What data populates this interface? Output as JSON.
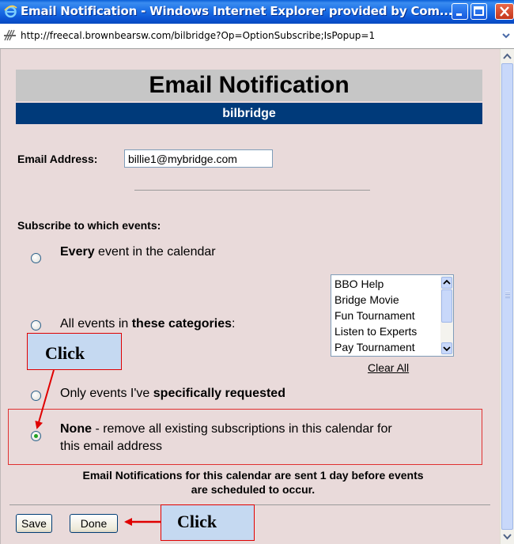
{
  "window": {
    "title": "Email Notification - Windows Internet Explorer provided by Com..."
  },
  "address_bar": {
    "url": "http://freecal.brownbearsw.com/bilbridge?Op=OptionSubscribe;IsPopup=1"
  },
  "page": {
    "heading": "Email Notification",
    "calendar_name": "bilbridge",
    "email_label": "Email Address:",
    "email_value": "billie1@mybridge.com",
    "subscribe_label": "Subscribe to which events:",
    "options": {
      "every": {
        "bold": "Every",
        "rest": " event in the calendar",
        "checked": false
      },
      "categories": {
        "pre": "All events in ",
        "bold": "these categories",
        "post": ":",
        "checked": false
      },
      "specific": {
        "pre": "Only events I've ",
        "bold": "specifically requested",
        "checked": false
      },
      "none": {
        "bold": "None",
        "line1_rest": " - remove all existing subscriptions in this calendar for",
        "line2": "this email address",
        "checked": true
      }
    },
    "categories_list": [
      "BBO Help",
      "Bridge Movie",
      "Fun Tournament",
      "Listen to Experts",
      "Pay Tournament"
    ],
    "clear_all": "Clear All",
    "footer_line1": "Email Notifications for this calendar are sent 1 day before events",
    "footer_line2": "are scheduled to occur.",
    "save_label": "Save",
    "done_label": "Done"
  },
  "annotations": {
    "click_top": "Click",
    "click_bottom": "Click",
    "color": "#e00000"
  },
  "colors": {
    "header_blue": "#003a7a",
    "header_gray": "#c6c6c6",
    "content_bg": "#e9dada",
    "titlebar": "#0a5fd8"
  }
}
